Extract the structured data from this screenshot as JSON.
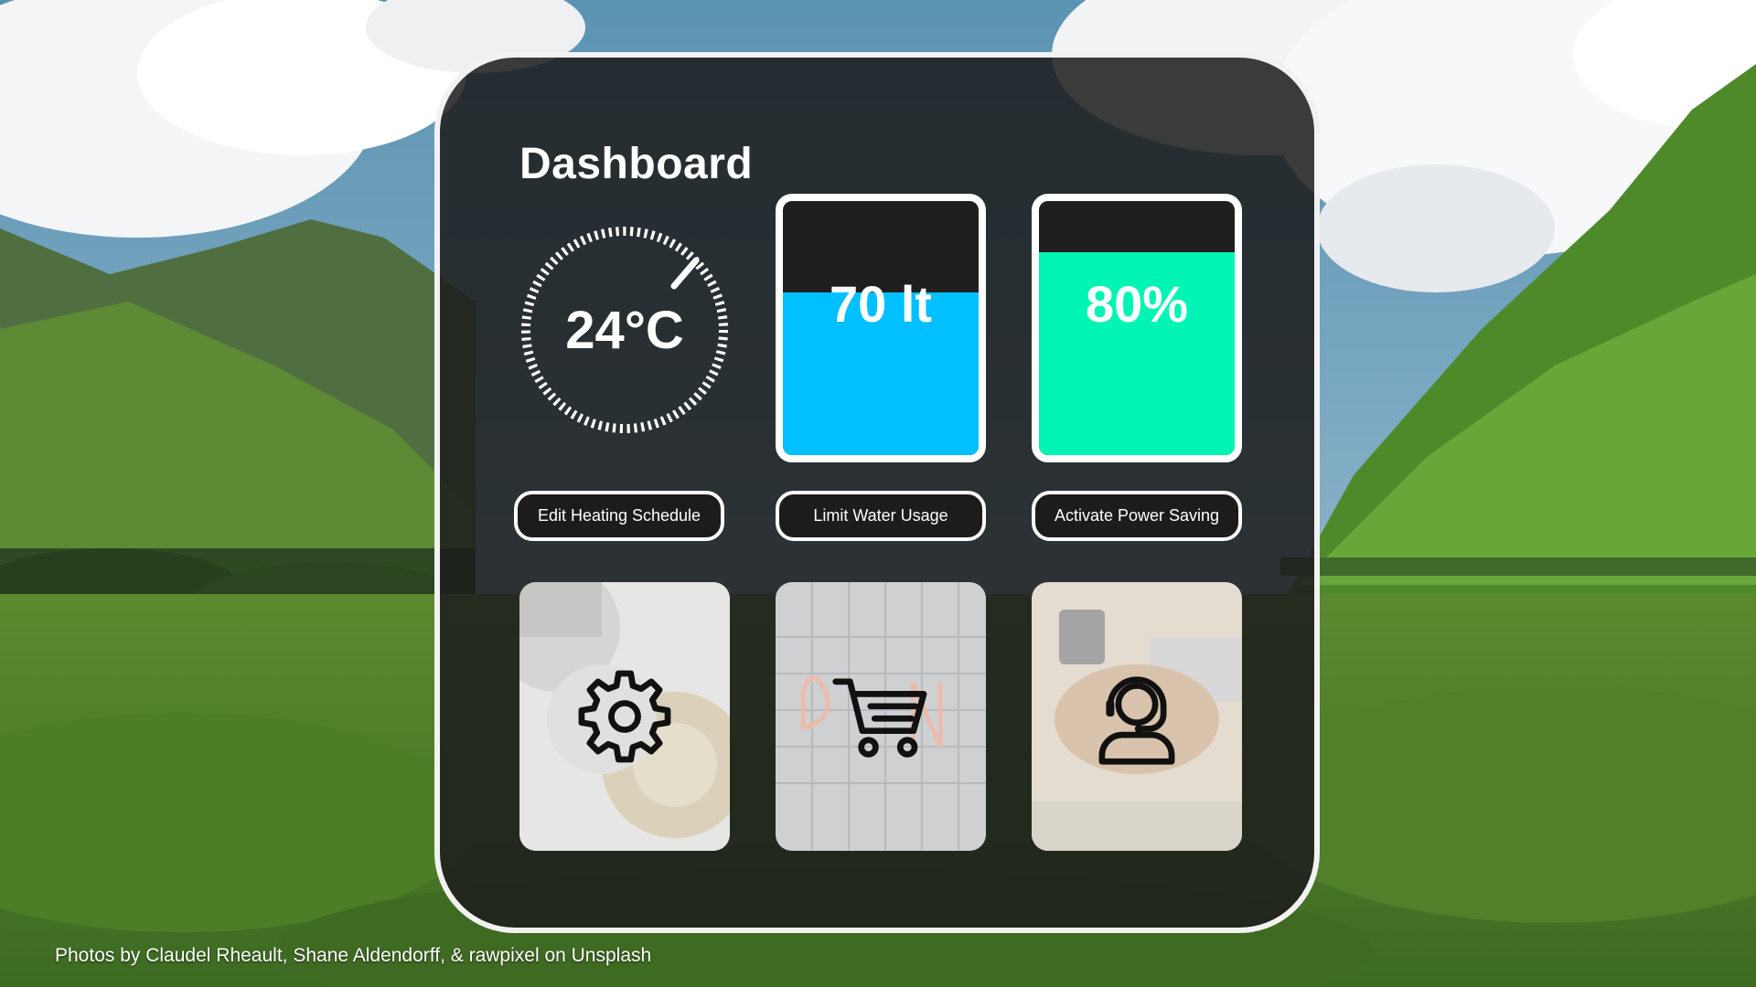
{
  "dashboard": {
    "title": "Dashboard"
  },
  "heating": {
    "temperature_label": "24°C",
    "button_label": "Edit Heating Schedule"
  },
  "water": {
    "level_label": "70 lt",
    "fill_fraction": 0.64,
    "fill_color": "#00c0ff",
    "button_label": "Limit Water Usage"
  },
  "power": {
    "level_label": "80%",
    "fill_fraction": 0.8,
    "fill_color": "#00f5b4",
    "button_label": "Activate Power Saving"
  },
  "tiles": [
    {
      "icon": "gear-icon",
      "photo": "mechanical gears"
    },
    {
      "icon": "shopping-cart-icon",
      "photo": "neon open sign"
    },
    {
      "icon": "customer-support-headset-icon",
      "photo": "team hands together"
    }
  ],
  "credit": {
    "text": "Photos by Claudel Rheault,  Shane Aldendorff, & rawpixel on Unsplash"
  },
  "colors": {
    "panel_background": "#1c1c1c",
    "panel_border": "#f2f2f2",
    "water_accent": "#00c0ff",
    "power_accent": "#00f5b4"
  }
}
